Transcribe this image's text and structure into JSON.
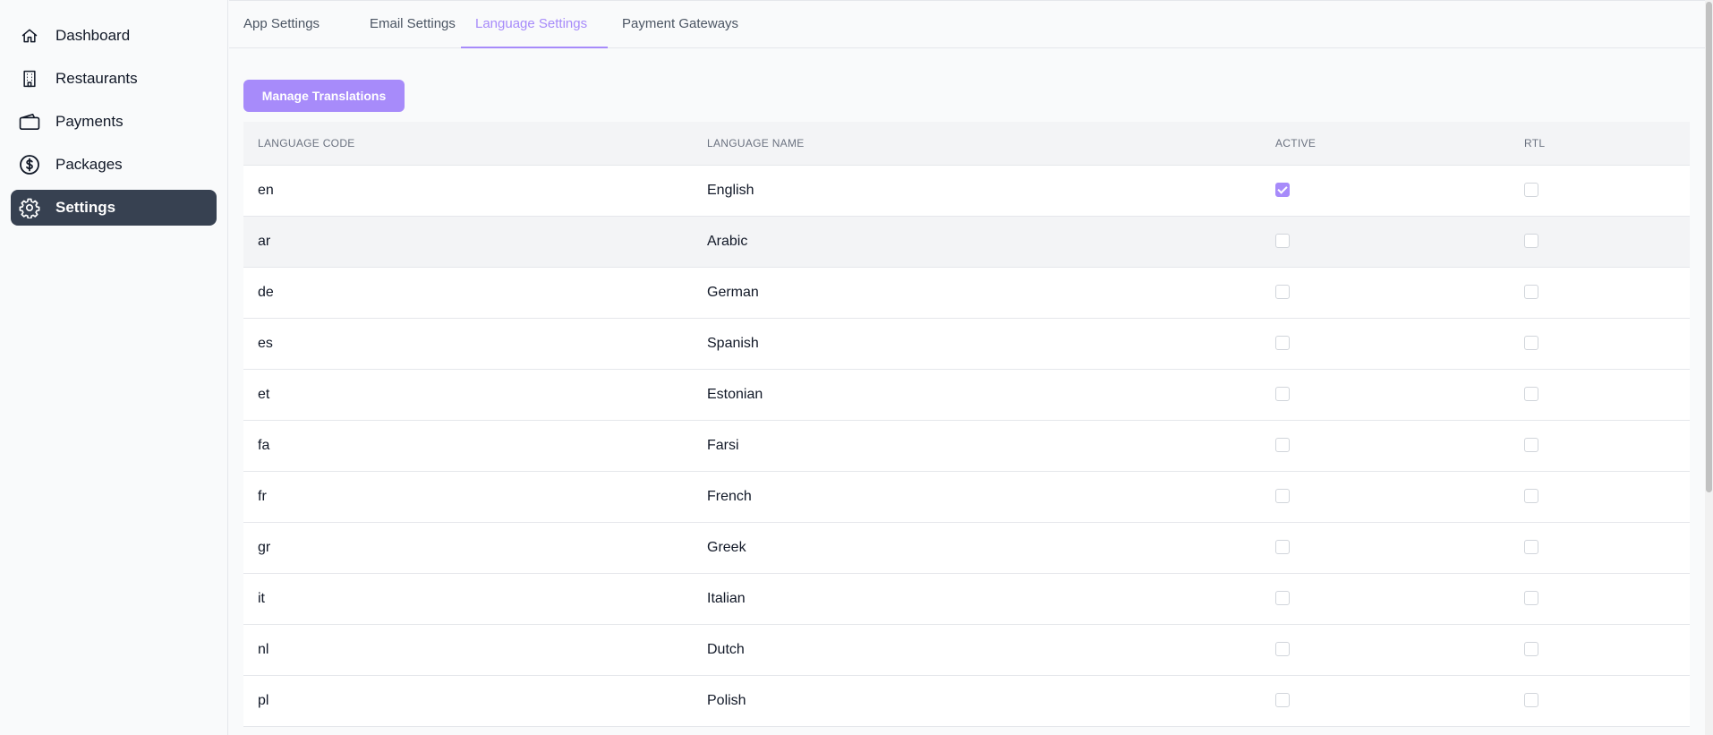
{
  "sidebar": {
    "items": [
      {
        "label": "Dashboard",
        "icon": "home-icon"
      },
      {
        "label": "Restaurants",
        "icon": "building-icon"
      },
      {
        "label": "Payments",
        "icon": "wallet-icon"
      },
      {
        "label": "Packages",
        "icon": "dollar-circle-icon"
      },
      {
        "label": "Settings",
        "icon": "gear-icon",
        "active": true
      }
    ]
  },
  "tabs": [
    {
      "label": "App Settings"
    },
    {
      "label": "Email Settings"
    },
    {
      "label": "Language Settings",
      "active": true
    },
    {
      "label": "Payment Gateways"
    }
  ],
  "manage_button": {
    "label": "Manage Translations"
  },
  "table": {
    "headers": {
      "code": "LANGUAGE CODE",
      "name": "LANGUAGE NAME",
      "active": "ACTIVE",
      "rtl": "RTL"
    },
    "rows": [
      {
        "code": "en",
        "name": "English",
        "active": true,
        "rtl": false
      },
      {
        "code": "ar",
        "name": "Arabic",
        "active": false,
        "rtl": false
      },
      {
        "code": "de",
        "name": "German",
        "active": false,
        "rtl": false
      },
      {
        "code": "es",
        "name": "Spanish",
        "active": false,
        "rtl": false
      },
      {
        "code": "et",
        "name": "Estonian",
        "active": false,
        "rtl": false
      },
      {
        "code": "fa",
        "name": "Farsi",
        "active": false,
        "rtl": false
      },
      {
        "code": "fr",
        "name": "French",
        "active": false,
        "rtl": false
      },
      {
        "code": "gr",
        "name": "Greek",
        "active": false,
        "rtl": false
      },
      {
        "code": "it",
        "name": "Italian",
        "active": false,
        "rtl": false
      },
      {
        "code": "nl",
        "name": "Dutch",
        "active": false,
        "rtl": false
      },
      {
        "code": "pl",
        "name": "Polish",
        "active": false,
        "rtl": false
      }
    ]
  },
  "colors": {
    "accent": "#a78bfa",
    "sidebar_active": "#374151"
  }
}
